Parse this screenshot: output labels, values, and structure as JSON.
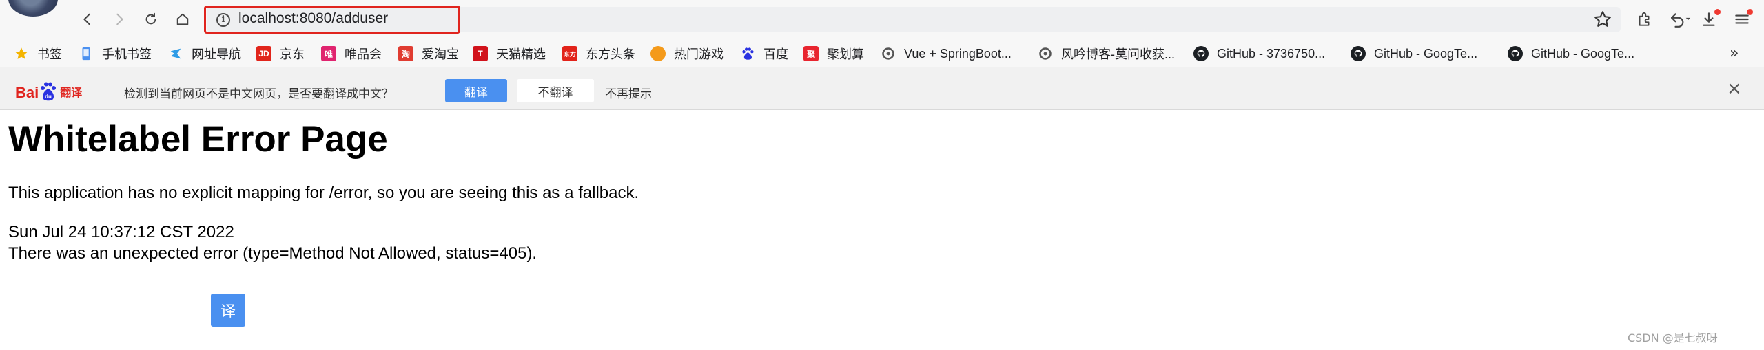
{
  "browser": {
    "url": "localhost:8080/adduser",
    "icons": [
      "back-icon",
      "forward-icon",
      "reload-icon",
      "home-icon",
      "info-icon",
      "star-icon",
      "extensions-icon",
      "undo-icon",
      "download-icon",
      "menu-icon"
    ],
    "colors": {
      "highlight": "#e0241e",
      "accent": "#4a90f0",
      "toolbar_bg": "#f7f7f7"
    }
  },
  "bookmarks": {
    "items": [
      {
        "label": "书签",
        "icon": "star-icon"
      },
      {
        "label": "手机书签",
        "icon": "phone-icon"
      },
      {
        "label": "网址导航",
        "icon": "navigation-icon"
      },
      {
        "label": "京东",
        "icon": "jd-icon",
        "glyph": "JD"
      },
      {
        "label": "唯品会",
        "icon": "vip-icon",
        "glyph": "唯"
      },
      {
        "label": "爱淘宝",
        "icon": "taobao-icon",
        "glyph": "淘"
      },
      {
        "label": "天猫精选",
        "icon": "tmall-icon",
        "glyph": "T"
      },
      {
        "label": "东方头条",
        "icon": "dongfang-icon",
        "glyph": "东方"
      },
      {
        "label": "热门游戏",
        "icon": "game-icon"
      },
      {
        "label": "百度",
        "icon": "baidu-icon"
      },
      {
        "label": "聚划算",
        "icon": "juhuasuan-icon",
        "glyph": "聚"
      },
      {
        "label": "Vue + SpringBoot...",
        "icon": "csdn-icon"
      },
      {
        "label": "风吟博客-莫问收获...",
        "icon": "blog-icon"
      },
      {
        "label": "GitHub - 3736750...",
        "icon": "github-icon"
      },
      {
        "label": "GitHub - GoogTe...",
        "icon": "github-icon"
      },
      {
        "label": "GitHub - GoogTe...",
        "icon": "github-icon"
      }
    ],
    "more": "»"
  },
  "translate_bar": {
    "logo_bai": "Bai",
    "logo_du": "du",
    "logo_fanyi": "翻译",
    "message": "检测到当前网页不是中文网页，是否要翻译成中文？",
    "translate_label": "翻译",
    "no_translate_label": "不翻译",
    "never_label": "不再提示",
    "close": "×"
  },
  "page": {
    "title": "Whitelabel Error Page",
    "message": "This application has no explicit mapping for /error, so you are seeing this as a fallback.",
    "timestamp": "Sun Jul 24 10:37:12 CST 2022",
    "error_detail": "There was an unexpected error (type=Method Not Allowed, status=405).",
    "float_translate_label": "译"
  },
  "watermark": "CSDN @是七叔呀"
}
